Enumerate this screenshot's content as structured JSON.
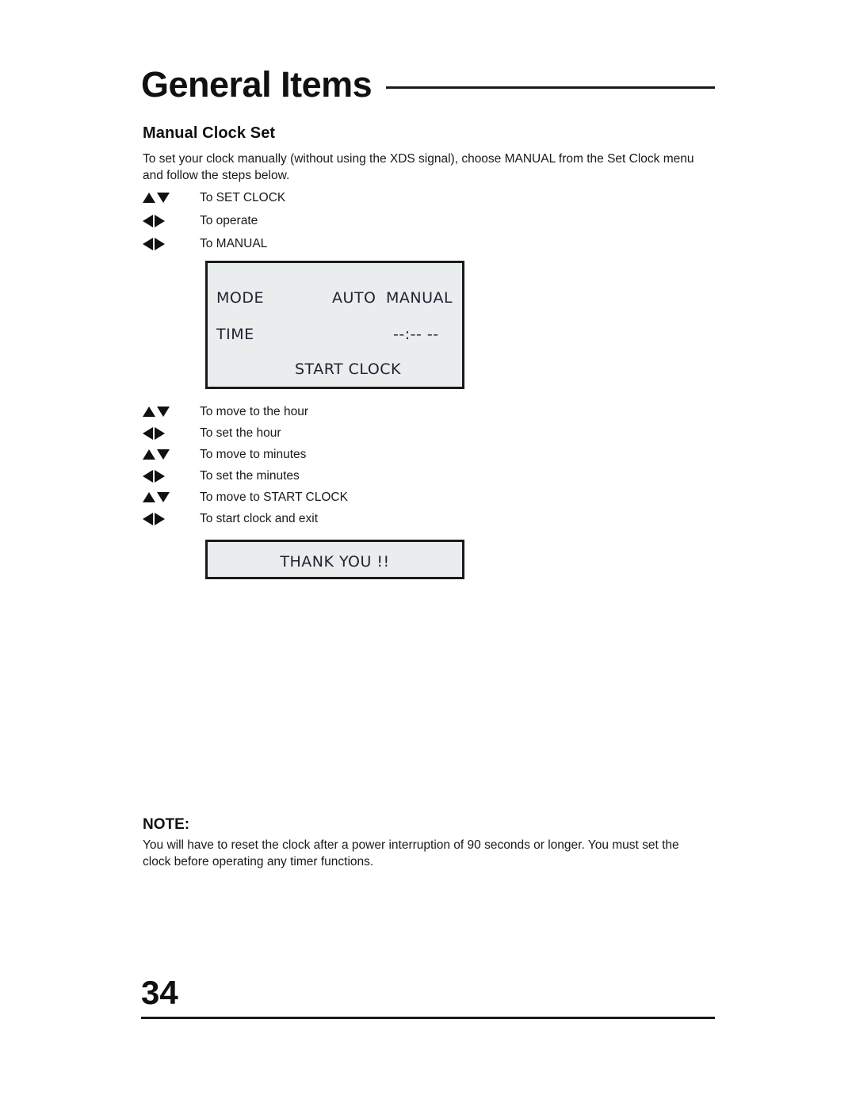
{
  "header": {
    "title": "General Items"
  },
  "section": {
    "heading": "Manual Clock Set",
    "intro": "To set your clock manually (without using the XDS signal), choose MANUAL from the Set Clock menu and follow the steps below."
  },
  "steps_top": [
    {
      "arrows": "up-down",
      "label": "To SET CLOCK"
    },
    {
      "arrows": "left-right",
      "label": "To operate"
    },
    {
      "arrows": "left-right",
      "label": "To MANUAL"
    }
  ],
  "osd_menu": {
    "mode_label": "MODE",
    "mode_auto": "AUTO",
    "mode_manual": "MANUAL",
    "time_label": "TIME",
    "time_value": "--:-- --",
    "start_clock": "START CLOCK"
  },
  "steps_bottom": [
    {
      "arrows": "up-down",
      "label": "To move to the hour"
    },
    {
      "arrows": "left-right",
      "label": "To set the hour"
    },
    {
      "arrows": "up-down",
      "label": "To move to minutes"
    },
    {
      "arrows": "left-right",
      "label": "To set the minutes"
    },
    {
      "arrows": "up-down",
      "label": "To move to START CLOCK"
    },
    {
      "arrows": "left-right",
      "label": "To start clock and exit"
    }
  ],
  "osd_thanks": {
    "text": "THANK YOU !!"
  },
  "note": {
    "heading": "NOTE:",
    "body": "You will have to reset the clock after a power interruption of 90 seconds or longer. You must set the clock before operating any timer functions."
  },
  "footer": {
    "page_number": "34"
  },
  "colors": {
    "ink": "#1a1a1a",
    "osd_fill": "#e9edee",
    "osd_border": "#1a1a1a",
    "osd_text": "#222230",
    "page_background": "#ffffff"
  }
}
